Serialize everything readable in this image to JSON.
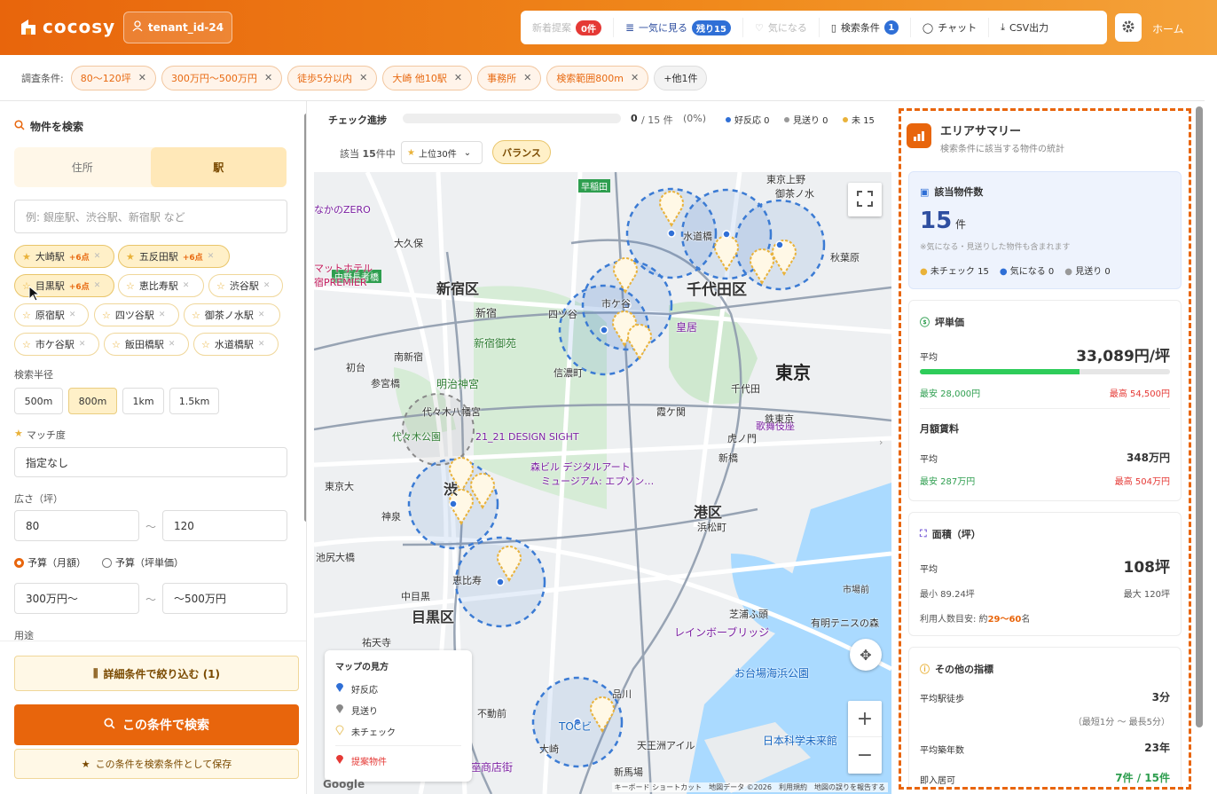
{
  "header": {
    "logo_text": "cocosy",
    "tenant": "tenant_id-24",
    "nav": [
      {
        "label": "新着提案",
        "badge": "0件"
      },
      {
        "label": "一気に見る",
        "badge": "残り15"
      },
      {
        "label": "気になる"
      },
      {
        "label": "検索条件",
        "badge": "1"
      },
      {
        "label": "チャット"
      },
      {
        "label": "CSV出力"
      }
    ],
    "home": "ホーム"
  },
  "conditions": {
    "label": "調査条件:",
    "chips": [
      "80〜120坪",
      "300万円〜500万円",
      "徒歩5分以内",
      "大崎 他10駅",
      "事務所",
      "検索範囲800m"
    ],
    "more": "+他1件"
  },
  "left": {
    "title": "物件を検索",
    "seg": [
      "住所",
      "駅"
    ],
    "station_placeholder": "例: 銀座駅、渋谷駅、新宿駅 など",
    "stations": [
      {
        "name": "大崎駅",
        "pts": "+6点"
      },
      {
        "name": "五反田駅",
        "pts": "+6点"
      },
      {
        "name": "目黒駅",
        "pts": "+6点"
      },
      {
        "name": "恵比寿駅"
      },
      {
        "name": "渋谷駅"
      },
      {
        "name": "原宿駅"
      },
      {
        "name": "四ツ谷駅"
      },
      {
        "name": "御茶ノ水駅"
      },
      {
        "name": "市ケ谷駅"
      },
      {
        "name": "飯田橋駅"
      },
      {
        "name": "水道橋駅"
      }
    ],
    "radius_label": "検索半径",
    "radius": [
      "500m",
      "800m",
      "1km",
      "1.5km"
    ],
    "match_label": "マッチ度",
    "match_value": "指定なし",
    "area_label": "広さ（坪）",
    "area_min": "80",
    "area_max": "120",
    "tilde": "〜",
    "budget_monthly": "予算（月額）",
    "budget_tsubo": "予算（坪単価）",
    "budget_min": "300万円〜",
    "budget_max": "〜500万円",
    "usage_label": "用途",
    "detail_btn": "詳細条件で絞り込む (1)",
    "search_btn": "この条件で検索",
    "save_btn": "この条件を検索条件として保存"
  },
  "progress": {
    "label": "チェック進捗",
    "done": "0",
    "total": "/ 15 件",
    "pct": "(0%)",
    "positive": "好反応 0",
    "skipped": "見送り 0",
    "unchecked": "未 15",
    "fraction": 0,
    "count_prefix": "該当",
    "count_value": "15",
    "count_suffix": "件中",
    "top_select": "上位30件",
    "mode": "バランス"
  },
  "map": {
    "labels": {
      "shinjuku": "新宿区",
      "chiyoda": "千代田区",
      "tokyo": "東京",
      "minato": "港区",
      "meguro": "目黒区",
      "shinjuku_st": "新宿",
      "ichigaya": "市ケ谷",
      "iidabashi": "水道橋",
      "kokyo": "皇居",
      "gyoen": "新宿御苑",
      "meiji": "明治神宮",
      "yoyogi": "代々木公園",
      "ebisu": "恵比寿",
      "akihabara": "秋葉原",
      "ueno": "東京上野",
      "design": "21_21 DESIGN SIGHT",
      "mori": "森ビル デジタルアート",
      "museum": "ミュージアム: エプソン…",
      "rainbow": "レインボーブリッジ",
      "odaiba": "お台場海浜公園",
      "shinagawa": "品川",
      "kabuki": "歌舞伎座",
      "hamamatsu": "浜松町",
      "shinbashi": "新橋",
      "tokyo_dai": "東京大",
      "nakano": "中野長者橋",
      "shibuya": "渋",
      "okubo": "大久保",
      "nakano_zero": "なかのZERO",
      "hotel": "マットホテル",
      "premier": "宿PREMIER",
      "waseda": "早稲田",
      "shiba": "芝浦ふ頭",
      "ariake": "有明テニスの森",
      "ichiba": "市場前",
      "kagaku": "日本科学未来館",
      "tennozu": "天王洲アイル",
      "nagata": "中目黒",
      "hatagaya": "初台",
      "sangubashi": "参宮橋",
      "yutenji": "祐天寺",
      "ikejiri": "池尻大橋",
      "kamiyama": "神泉",
      "gotanda": "大崎",
      "fudomae": "不動前",
      "toc": "TOCビ",
      "kitashinagawa": "新馬場",
      "ginza": "座商店街",
      "kanda": "鉄東京",
      "kasumi": "霞ケ関",
      "toranomon": "虎ノ門",
      "ochanomizu": "御茶ノ水",
      "minamishinjuku": "南新宿",
      "daikanyama": "代々木八幡宮",
      "shinanomachi": "信濃町",
      "sanbancho": "四ツ谷",
      "kojimachi": "千代田"
    },
    "legend_title": "マップの見方",
    "legend": [
      "好反応",
      "見送り",
      "未チェック",
      "提案物件"
    ],
    "footer": "キーボード ショートカット　地図データ ©2026　利用規約　地図の誤りを報告する",
    "google": "Google"
  },
  "summary": {
    "title": "エリアサマリー",
    "subtitle": "検索条件に該当する物件の統計",
    "count_title": "該当物件数",
    "count": "15",
    "count_unit": "件",
    "count_note": "※気になる・見送りした物件も含まれます",
    "status": [
      "未チェック 15",
      "気になる 0",
      "見送り 0"
    ],
    "tsubo_title": "坪単価",
    "avg_label": "平均",
    "tsubo_avg": "33,089円/坪",
    "tsubo_fraction": 0.64,
    "tsubo_min": "最安 28,000円",
    "tsubo_max": "最高 54,500円",
    "rent_title": "月額賃料",
    "rent_avg": "348万円",
    "rent_min": "最安 287万円",
    "rent_max": "最高 504万円",
    "area_title": "面積（坪）",
    "area_avg": "108坪",
    "area_min": "最小 89.24坪",
    "area_max": "最大 120坪",
    "people_prefix": "利用人数目安: 約",
    "people_range": "29〜60",
    "people_suffix": "名",
    "other_title": "その他の指標",
    "walk_label": "平均駅徒歩",
    "walk_value": "3分",
    "walk_range": "（最短1分 〜 最長5分）",
    "age_label": "平均築年数",
    "age_value": "23年",
    "movein_label": "即入居可",
    "movein_value": "7件 / 15件"
  },
  "colors": {
    "accent": "#e8650c",
    "blue": "#2f6fd6",
    "green": "#2e9e4f",
    "red": "#e53935"
  }
}
